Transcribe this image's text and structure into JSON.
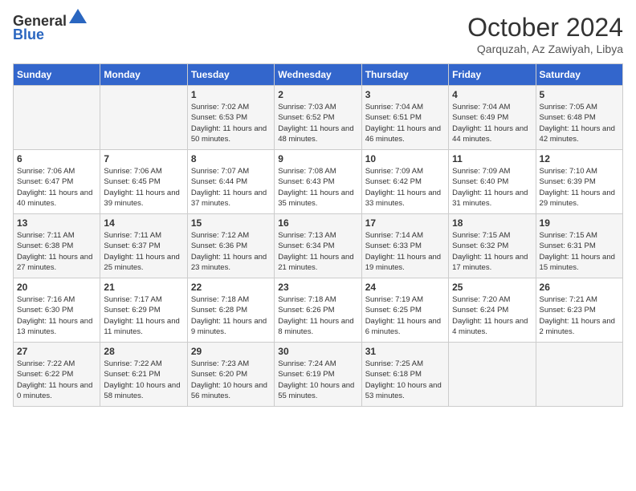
{
  "header": {
    "logo_line1": "General",
    "logo_line2": "Blue",
    "month": "October 2024",
    "location": "Qarquzah, Az Zawiyah, Libya"
  },
  "days_of_week": [
    "Sunday",
    "Monday",
    "Tuesday",
    "Wednesday",
    "Thursday",
    "Friday",
    "Saturday"
  ],
  "weeks": [
    [
      {
        "day": "",
        "info": ""
      },
      {
        "day": "",
        "info": ""
      },
      {
        "day": "1",
        "info": "Sunrise: 7:02 AM\nSunset: 6:53 PM\nDaylight: 11 hours and 50 minutes."
      },
      {
        "day": "2",
        "info": "Sunrise: 7:03 AM\nSunset: 6:52 PM\nDaylight: 11 hours and 48 minutes."
      },
      {
        "day": "3",
        "info": "Sunrise: 7:04 AM\nSunset: 6:51 PM\nDaylight: 11 hours and 46 minutes."
      },
      {
        "day": "4",
        "info": "Sunrise: 7:04 AM\nSunset: 6:49 PM\nDaylight: 11 hours and 44 minutes."
      },
      {
        "day": "5",
        "info": "Sunrise: 7:05 AM\nSunset: 6:48 PM\nDaylight: 11 hours and 42 minutes."
      }
    ],
    [
      {
        "day": "6",
        "info": "Sunrise: 7:06 AM\nSunset: 6:47 PM\nDaylight: 11 hours and 40 minutes."
      },
      {
        "day": "7",
        "info": "Sunrise: 7:06 AM\nSunset: 6:45 PM\nDaylight: 11 hours and 39 minutes."
      },
      {
        "day": "8",
        "info": "Sunrise: 7:07 AM\nSunset: 6:44 PM\nDaylight: 11 hours and 37 minutes."
      },
      {
        "day": "9",
        "info": "Sunrise: 7:08 AM\nSunset: 6:43 PM\nDaylight: 11 hours and 35 minutes."
      },
      {
        "day": "10",
        "info": "Sunrise: 7:09 AM\nSunset: 6:42 PM\nDaylight: 11 hours and 33 minutes."
      },
      {
        "day": "11",
        "info": "Sunrise: 7:09 AM\nSunset: 6:40 PM\nDaylight: 11 hours and 31 minutes."
      },
      {
        "day": "12",
        "info": "Sunrise: 7:10 AM\nSunset: 6:39 PM\nDaylight: 11 hours and 29 minutes."
      }
    ],
    [
      {
        "day": "13",
        "info": "Sunrise: 7:11 AM\nSunset: 6:38 PM\nDaylight: 11 hours and 27 minutes."
      },
      {
        "day": "14",
        "info": "Sunrise: 7:11 AM\nSunset: 6:37 PM\nDaylight: 11 hours and 25 minutes."
      },
      {
        "day": "15",
        "info": "Sunrise: 7:12 AM\nSunset: 6:36 PM\nDaylight: 11 hours and 23 minutes."
      },
      {
        "day": "16",
        "info": "Sunrise: 7:13 AM\nSunset: 6:34 PM\nDaylight: 11 hours and 21 minutes."
      },
      {
        "day": "17",
        "info": "Sunrise: 7:14 AM\nSunset: 6:33 PM\nDaylight: 11 hours and 19 minutes."
      },
      {
        "day": "18",
        "info": "Sunrise: 7:15 AM\nSunset: 6:32 PM\nDaylight: 11 hours and 17 minutes."
      },
      {
        "day": "19",
        "info": "Sunrise: 7:15 AM\nSunset: 6:31 PM\nDaylight: 11 hours and 15 minutes."
      }
    ],
    [
      {
        "day": "20",
        "info": "Sunrise: 7:16 AM\nSunset: 6:30 PM\nDaylight: 11 hours and 13 minutes."
      },
      {
        "day": "21",
        "info": "Sunrise: 7:17 AM\nSunset: 6:29 PM\nDaylight: 11 hours and 11 minutes."
      },
      {
        "day": "22",
        "info": "Sunrise: 7:18 AM\nSunset: 6:28 PM\nDaylight: 11 hours and 9 minutes."
      },
      {
        "day": "23",
        "info": "Sunrise: 7:18 AM\nSunset: 6:26 PM\nDaylight: 11 hours and 8 minutes."
      },
      {
        "day": "24",
        "info": "Sunrise: 7:19 AM\nSunset: 6:25 PM\nDaylight: 11 hours and 6 minutes."
      },
      {
        "day": "25",
        "info": "Sunrise: 7:20 AM\nSunset: 6:24 PM\nDaylight: 11 hours and 4 minutes."
      },
      {
        "day": "26",
        "info": "Sunrise: 7:21 AM\nSunset: 6:23 PM\nDaylight: 11 hours and 2 minutes."
      }
    ],
    [
      {
        "day": "27",
        "info": "Sunrise: 7:22 AM\nSunset: 6:22 PM\nDaylight: 11 hours and 0 minutes."
      },
      {
        "day": "28",
        "info": "Sunrise: 7:22 AM\nSunset: 6:21 PM\nDaylight: 10 hours and 58 minutes."
      },
      {
        "day": "29",
        "info": "Sunrise: 7:23 AM\nSunset: 6:20 PM\nDaylight: 10 hours and 56 minutes."
      },
      {
        "day": "30",
        "info": "Sunrise: 7:24 AM\nSunset: 6:19 PM\nDaylight: 10 hours and 55 minutes."
      },
      {
        "day": "31",
        "info": "Sunrise: 7:25 AM\nSunset: 6:18 PM\nDaylight: 10 hours and 53 minutes."
      },
      {
        "day": "",
        "info": ""
      },
      {
        "day": "",
        "info": ""
      }
    ]
  ]
}
